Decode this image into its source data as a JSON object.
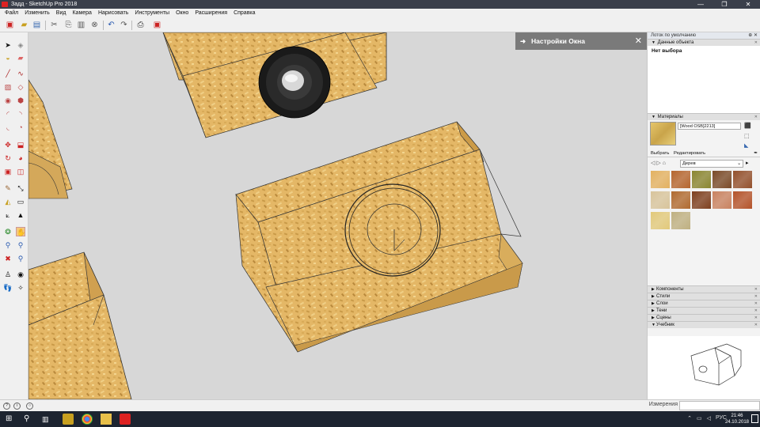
{
  "window": {
    "title": "Задд - SketchUp Pro 2018",
    "controls": [
      "—",
      "❐",
      "✕"
    ]
  },
  "menu": [
    "Файл",
    "Изменить",
    "Вид",
    "Камера",
    "Нарисовать",
    "Инструменты",
    "Окно",
    "Расширения",
    "Справка"
  ],
  "popup": {
    "title": "Настройки Окна",
    "arrow": "➜",
    "close": "✕"
  },
  "tray": {
    "title": "Лоток по умолчанию",
    "entity_info": {
      "header": "Данные объекта",
      "value": "Нет выбора"
    },
    "materials": {
      "header": "Материалы",
      "name": "[Wood OSB]2213]",
      "tab_select": "Выбрать",
      "tab_edit": "Редактировать",
      "library": "Дерев",
      "swatch_colors": [
        "#e3b160",
        "#b5652e",
        "#8a8530",
        "#7a4a28",
        "#93502c",
        "#d8c49b",
        "#b06a30",
        "#7e3f1e",
        "#c98260",
        "#b4532a",
        "#e2c97a",
        "#bfb081"
      ]
    },
    "collapsed_panels": [
      "Компоненты",
      "Стили",
      "Слои",
      "Тени",
      "Сцены",
      "Учебник"
    ]
  },
  "statusbar": {
    "measurements_label": "Измерения"
  },
  "taskbar": {
    "language": "РУС",
    "time": "21:46",
    "date": "24.10.2018"
  }
}
